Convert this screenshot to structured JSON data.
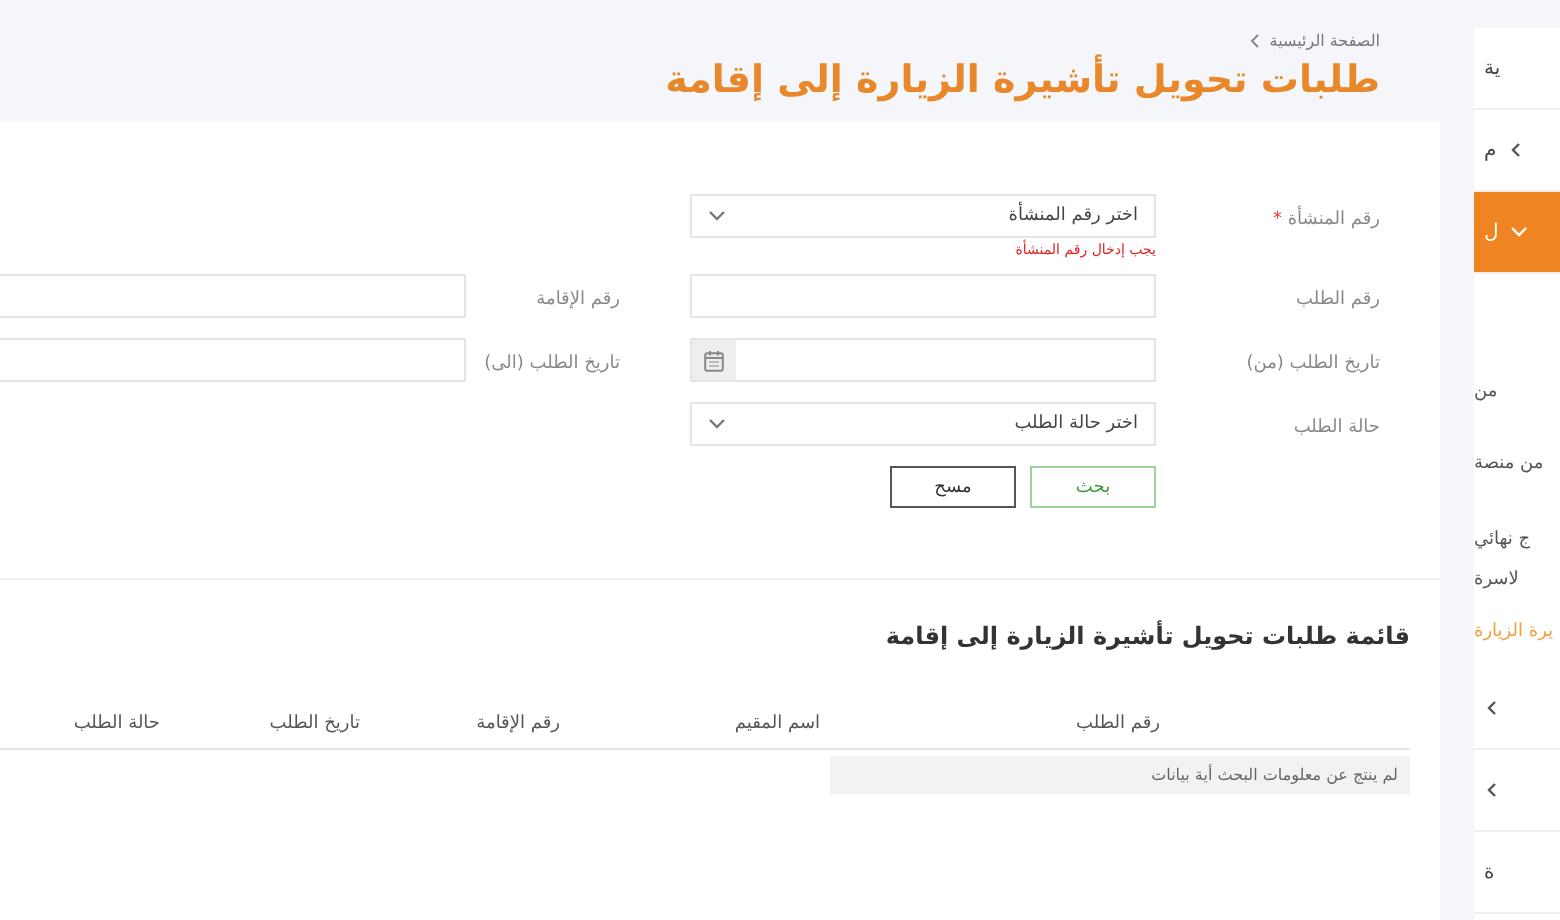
{
  "breadcrumb": {
    "label": "الصفحة الرئيسية"
  },
  "title": "طلبات تحويل تأشيرة الزيارة إلى إقامة",
  "sidebar": {
    "items": [
      {
        "label": "ية",
        "kind": "link",
        "selected": false
      },
      {
        "label": "م",
        "kind": "parent",
        "selected": false,
        "expanded": false
      },
      {
        "label": "ل",
        "kind": "parent",
        "selected": true,
        "expanded": true,
        "children": [
          {
            "label": "من",
            "selected": false
          },
          {
            "label": "من منصة",
            "selected": false
          },
          {
            "label": "ج نهائي",
            "selected": false
          },
          {
            "label": "لاسرة",
            "selected": false
          },
          {
            "label": "يرة الزيارة",
            "selected": true
          }
        ]
      },
      {
        "kind": "parent",
        "selected": false,
        "expanded": false
      },
      {
        "kind": "parent",
        "selected": false,
        "expanded": false
      },
      {
        "label": "ة",
        "kind": "link",
        "selected": false
      }
    ]
  },
  "form": {
    "fields": [
      {
        "label": "رقم المنشأة",
        "kind": "select",
        "required_mark": "*",
        "placeholder": "اختر رقم المنشأة",
        "error": "يجب إدخال رقم المنشأة"
      },
      {
        "kind": "blank"
      },
      {
        "label": "رقم الطلب",
        "kind": "text"
      },
      {
        "label": "رقم الإقامة",
        "kind": "text"
      },
      {
        "label": "تاريخ الطلب (من)",
        "kind": "date"
      },
      {
        "label": "تاريخ الطلب (الى)",
        "kind": "date"
      },
      {
        "label": "حالة الطلب",
        "kind": "select",
        "placeholder": "اختر حالة الطلب"
      }
    ],
    "buttons": [
      {
        "label": "بحث",
        "kind": "primary"
      },
      {
        "label": "مسح",
        "kind": "secondary"
      }
    ]
  },
  "list": {
    "title": "قائمة طلبات تحويل تأشيرة الزيارة إلى إقامة",
    "columns": [
      "رقم الطلب",
      "اسم المقيم",
      "رقم الإقامة",
      "تاريخ الطلب",
      "حالة الطلب"
    ],
    "empty_message": "لم ينتج عن معلومات البحث أية بيانات"
  }
}
